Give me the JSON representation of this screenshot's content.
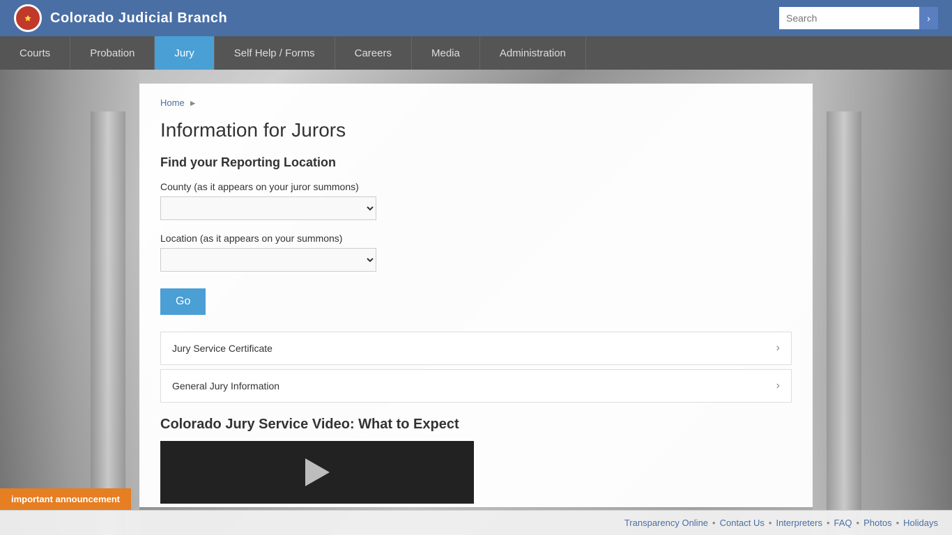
{
  "header": {
    "logo_text": "Colorado Judicial Branch",
    "logo_abbr": "CO",
    "search_placeholder": "Search",
    "search_btn_label": "›"
  },
  "nav": {
    "items": [
      {
        "id": "courts",
        "label": "Courts",
        "active": false
      },
      {
        "id": "probation",
        "label": "Probation",
        "active": false
      },
      {
        "id": "jury",
        "label": "Jury",
        "active": true
      },
      {
        "id": "selfhelp",
        "label": "Self Help / Forms",
        "active": false
      },
      {
        "id": "careers",
        "label": "Careers",
        "active": false
      },
      {
        "id": "media",
        "label": "Media",
        "active": false
      },
      {
        "id": "administration",
        "label": "Administration",
        "active": false
      }
    ]
  },
  "breadcrumb": {
    "home": "Home"
  },
  "page": {
    "title": "Information for Jurors",
    "find_section_title": "Find your Reporting Location",
    "county_label": "County (as it appears on your juror summons)",
    "location_label": "Location (as it appears on your summons)",
    "go_button": "Go",
    "list_items": [
      {
        "id": "jury-service-certificate",
        "label": "Jury Service Certificate"
      },
      {
        "id": "general-jury-info",
        "label": "General Jury Information"
      }
    ],
    "video_section_title": "Colorado Jury Service Video: What to Expect"
  },
  "footer": {
    "links": [
      {
        "id": "transparency",
        "label": "Transparency Online"
      },
      {
        "id": "contact",
        "label": "Contact Us"
      },
      {
        "id": "interpreters",
        "label": "Interpreters"
      },
      {
        "id": "faq",
        "label": "FAQ"
      },
      {
        "id": "photos",
        "label": "Photos"
      },
      {
        "id": "holidays",
        "label": "Holidays"
      }
    ]
  },
  "announcement": {
    "label": "important announcement"
  }
}
